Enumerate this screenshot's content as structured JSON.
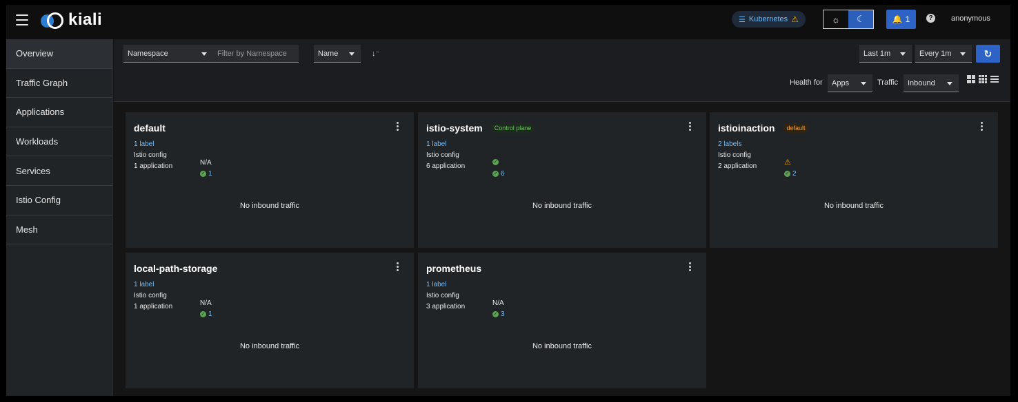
{
  "masthead": {
    "logo_text": "kiali",
    "cluster_label": "Kubernetes",
    "notification_count": "1",
    "help_symbol": "?",
    "user": "anonymous",
    "theme_light_icon": "sun-icon",
    "theme_dark_icon": "moon-icon"
  },
  "sidebar": {
    "items": [
      {
        "label": "Overview"
      },
      {
        "label": "Traffic Graph"
      },
      {
        "label": "Applications"
      },
      {
        "label": "Workloads"
      },
      {
        "label": "Services"
      },
      {
        "label": "Istio Config"
      },
      {
        "label": "Mesh"
      }
    ]
  },
  "toolbar": {
    "filter_type": "Namespace",
    "filter_placeholder": "Filter by Namespace",
    "sort_by": "Name",
    "sort_icon": "sort-alpha-icon",
    "time_range": "Last 1m",
    "refresh_interval": "Every 1m",
    "health_for_label": "Health for",
    "health_for_value": "Apps",
    "traffic_label": "Traffic",
    "traffic_value": "Inbound"
  },
  "cards": [
    {
      "name": "default",
      "tag": "",
      "labels": "1 label",
      "istio_config_label": "Istio config",
      "istio_config": "N/A",
      "apps_label": "1 application",
      "apps_count": "1",
      "traffic": "No inbound traffic"
    },
    {
      "name": "istio-system",
      "tag": "Control plane",
      "labels": "1 label",
      "istio_config_label": "Istio config",
      "istio_config": "",
      "apps_label": "6 application",
      "apps_count": "6",
      "traffic": "No inbound traffic"
    },
    {
      "name": "istioinaction",
      "tag": "default",
      "labels": "2 labels",
      "istio_config_label": "Istio config",
      "istio_config": "",
      "apps_label": "2 application",
      "apps_count": "2",
      "traffic": "No inbound traffic"
    },
    {
      "name": "local-path-storage",
      "tag": "",
      "labels": "1 label",
      "istio_config_label": "Istio config",
      "istio_config": "N/A",
      "apps_label": "1 application",
      "apps_count": "1",
      "traffic": "No inbound traffic"
    },
    {
      "name": "prometheus",
      "tag": "",
      "labels": "1 label",
      "istio_config_label": "Istio config",
      "istio_config": "N/A",
      "apps_label": "3 application",
      "apps_count": "3",
      "traffic": "No inbound traffic"
    }
  ],
  "colors": {
    "accent": "#2d63c6",
    "link": "#73bcf7",
    "success": "#5ba352",
    "warning": "#f0ab00"
  }
}
